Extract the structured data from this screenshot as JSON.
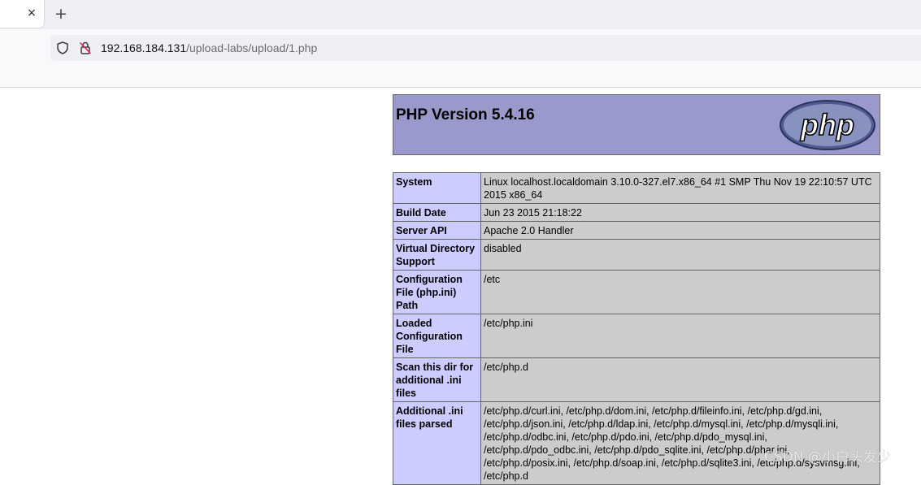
{
  "browser": {
    "tab_close_glyph": "×",
    "new_tab_glyph": "+",
    "url_host": "192.168.184.131",
    "url_path": "/upload-labs/upload/1.php",
    "icons": [
      "shield-icon",
      "insecure-lock-icon"
    ]
  },
  "phpinfo": {
    "title": "PHP Version 5.4.16",
    "logo_text": "php",
    "rows": [
      {
        "key": "System",
        "value": "Linux localhost.localdomain 3.10.0-327.el7.x86_64 #1 SMP Thu Nov 19 22:10:57 UTC 2015 x86_64"
      },
      {
        "key": "Build Date",
        "value": "Jun 23 2015 21:18:22"
      },
      {
        "key": "Server API",
        "value": "Apache 2.0 Handler"
      },
      {
        "key": "Virtual Directory Support",
        "value": "disabled"
      },
      {
        "key": "Configuration File (php.ini) Path",
        "value": "/etc"
      },
      {
        "key": "Loaded Configuration File",
        "value": "/etc/php.ini"
      },
      {
        "key": "Scan this dir for additional .ini files",
        "value": "/etc/php.d"
      },
      {
        "key": "Additional .ini files parsed",
        "value": "/etc/php.d/curl.ini, /etc/php.d/dom.ini, /etc/php.d/fileinfo.ini, /etc/php.d/gd.ini, /etc/php.d/json.ini, /etc/php.d/ldap.ini, /etc/php.d/mysql.ini, /etc/php.d/mysqli.ini, /etc/php.d/odbc.ini, /etc/php.d/pdo.ini, /etc/php.d/pdo_mysql.ini, /etc/php.d/pdo_odbc.ini, /etc/php.d/pdo_sqlite.ini, /etc/php.d/phar.ini, /etc/php.d/posix.ini, /etc/php.d/soap.ini, /etc/php.d/sqlite3.ini, /etc/php.d/sysvmsg.ini, /etc/php.d"
      }
    ],
    "header_bg": "#9999cc",
    "key_bg": "#ccccff",
    "value_bg": "#cccccc"
  },
  "watermark": "CSDN @小白头发少"
}
